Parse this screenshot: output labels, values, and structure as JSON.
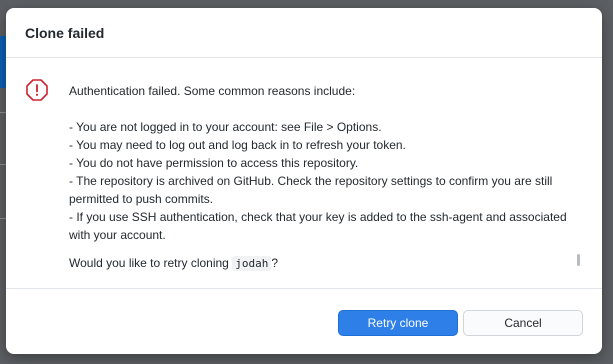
{
  "dialog": {
    "title": "Clone failed",
    "icon": "alert-octagon-icon",
    "intro": "Authentication failed. Some common reasons include:",
    "reasons": [
      "- You are not logged in to your account: see File > Options.",
      "- You may need to log out and log back in to refresh your token.",
      "- You do not have permission to access this repository.",
      "- The repository is archived on GitHub. Check the repository settings to confirm you are still permitted to push commits.",
      "- If you use SSH authentication, check that your key is added to the ssh-agent and associated with your account."
    ],
    "retry_prefix": "Would you like to retry cloning",
    "repo_name": "jodah",
    "retry_suffix": "?",
    "buttons": {
      "retry_label": "Retry clone",
      "cancel_label": "Cancel"
    }
  },
  "colors": {
    "primary": "#2f7fe8",
    "error": "#cb2431",
    "backdrop": "#5c5f63"
  }
}
